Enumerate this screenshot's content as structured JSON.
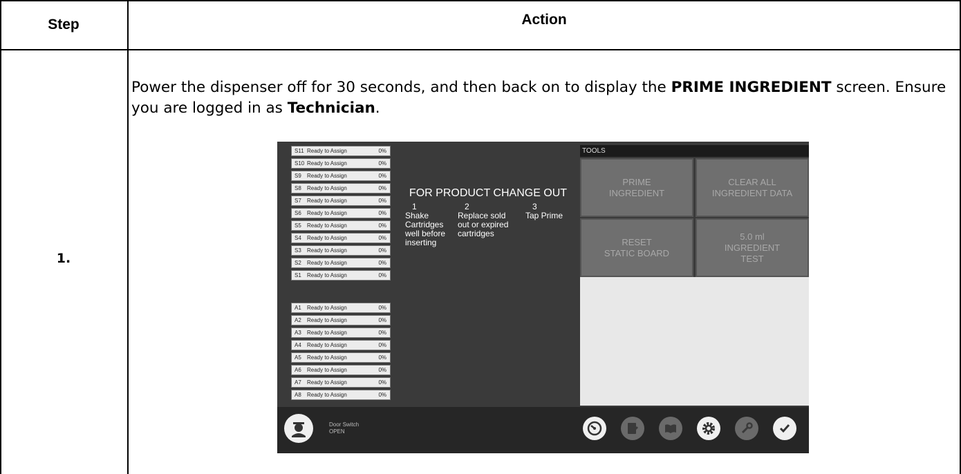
{
  "table": {
    "header_step": "Step",
    "header_action": "Action",
    "step_number": "1."
  },
  "instruction": {
    "part1": "Power the dispenser off for 30 seconds, and then back on to display the ",
    "bold1": "PRIME INGREDIENT",
    "part2": " screen.  Ensure you are logged in as ",
    "bold2": "Technician",
    "part3": "."
  },
  "screen": {
    "s_slots": [
      {
        "id": "S11",
        "status": "Ready to Assign",
        "pct": "0%"
      },
      {
        "id": "S10",
        "status": "Ready to Assign",
        "pct": "0%"
      },
      {
        "id": "S9",
        "status": "Ready to Assign",
        "pct": "0%"
      },
      {
        "id": "S8",
        "status": "Ready to Assign",
        "pct": "0%"
      },
      {
        "id": "S7",
        "status": "Ready to Assign",
        "pct": "0%"
      },
      {
        "id": "S6",
        "status": "Ready to Assign",
        "pct": "0%"
      },
      {
        "id": "S5",
        "status": "Ready to Assign",
        "pct": "0%"
      },
      {
        "id": "S4",
        "status": "Ready to Assign",
        "pct": "0%"
      },
      {
        "id": "S3",
        "status": "Ready to Assign",
        "pct": "0%"
      },
      {
        "id": "S2",
        "status": "Ready to Assign",
        "pct": "0%"
      },
      {
        "id": "S1",
        "status": "Ready to Assign",
        "pct": "0%"
      }
    ],
    "a_slots": [
      {
        "id": "A1",
        "status": "Ready to Assign",
        "pct": "0%"
      },
      {
        "id": "A2",
        "status": "Ready to Assign",
        "pct": "0%"
      },
      {
        "id": "A3",
        "status": "Ready to Assign",
        "pct": "0%"
      },
      {
        "id": "A4",
        "status": "Ready to Assign",
        "pct": "0%"
      },
      {
        "id": "A5",
        "status": "Ready to Assign",
        "pct": "0%"
      },
      {
        "id": "A6",
        "status": "Ready to Assign",
        "pct": "0%"
      },
      {
        "id": "A7",
        "status": "Ready to Assign",
        "pct": "0%"
      },
      {
        "id": "A8",
        "status": "Ready to Assign",
        "pct": "0%"
      }
    ],
    "changeout": {
      "title": "FOR PRODUCT CHANGE OUT",
      "step1_num": "1",
      "step1_text": "Shake\nCartridges\nwell before\ninserting",
      "step2_num": "2",
      "step2_text": "Replace sold\nout or expired\ncartridges",
      "step3_num": "3",
      "step3_text": "Tap Prime"
    },
    "tools": {
      "header": "TOOLS",
      "prime": "PRIME\nINGREDIENT",
      "clear": "CLEAR ALL\nINGREDIENT DATA",
      "reset": "RESET\nSTATIC BOARD",
      "test": "5.0 ml\nINGREDIENT\nTEST"
    },
    "footer": {
      "door_label": "Door Switch",
      "door_state": "OPEN",
      "icons": [
        "gauge-icon",
        "edit-icon",
        "book-icon",
        "gear-icon",
        "wrench-icon",
        "check-icon"
      ]
    }
  }
}
